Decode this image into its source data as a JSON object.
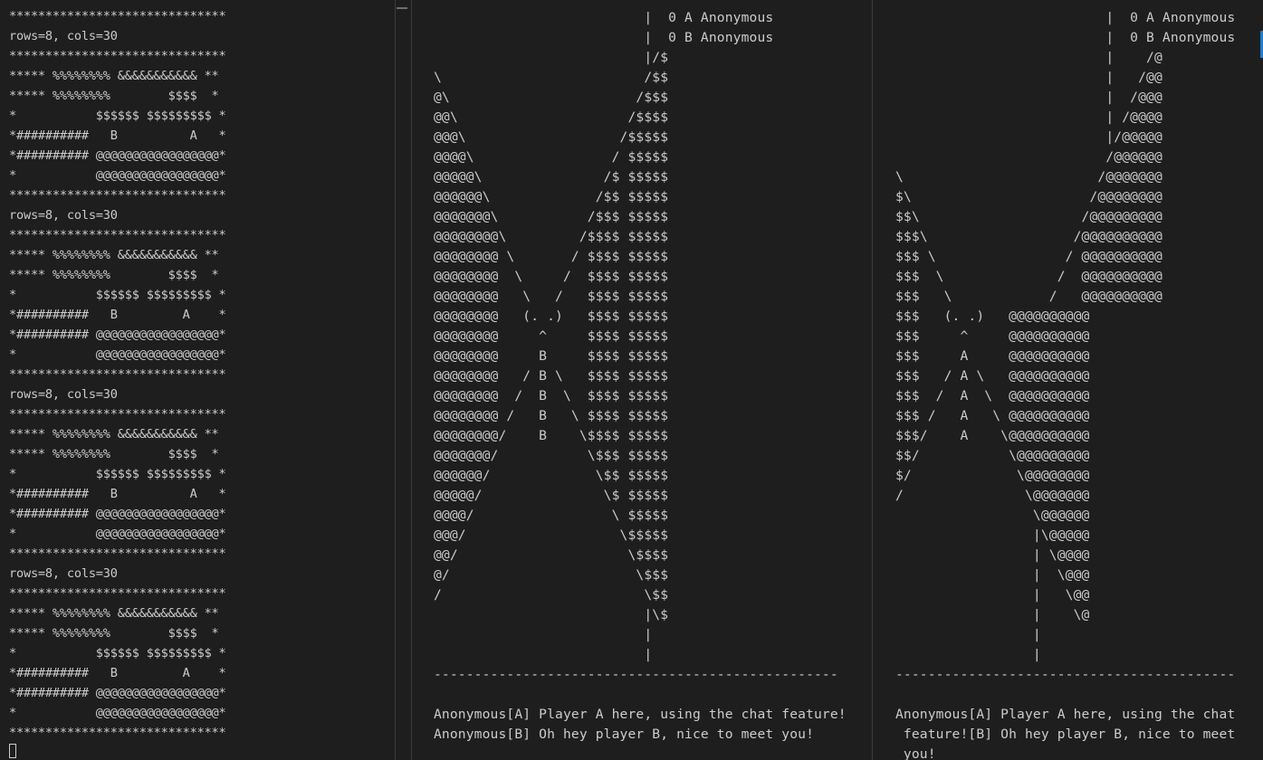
{
  "left_terminal": {
    "lines": [
      "******************************",
      "rows=8, cols=30",
      "******************************",
      "***** %%%%%%%% &&&&&&&&&&& **",
      "***** %%%%%%%%        $$$$  *",
      "*           $$$$$$ $$$$$$$$$ *",
      "*##########   B          A   *",
      "*########## @@@@@@@@@@@@@@@@@*",
      "*           @@@@@@@@@@@@@@@@@*",
      "******************************",
      "rows=8, cols=30",
      "******************************",
      "***** %%%%%%%% &&&&&&&&&&& **",
      "***** %%%%%%%%        $$$$  *",
      "*           $$$$$$ $$$$$$$$$ *",
      "*##########   B         A    *",
      "*########## @@@@@@@@@@@@@@@@@*",
      "*           @@@@@@@@@@@@@@@@@*",
      "******************************",
      "rows=8, cols=30",
      "******************************",
      "***** %%%%%%%% &&&&&&&&&&& **",
      "***** %%%%%%%%        $$$$  *",
      "*           $$$$$$ $$$$$$$$$ *",
      "*##########   B          A   *",
      "*########## @@@@@@@@@@@@@@@@@*",
      "*           @@@@@@@@@@@@@@@@@*",
      "******************************",
      "rows=8, cols=30",
      "******************************",
      "***** %%%%%%%% &&&&&&&&&&& **",
      "***** %%%%%%%%        $$$$  *",
      "*           $$$$$$ $$$$$$$$$ *",
      "*##########   B         A    *",
      "*########## @@@@@@@@@@@@@@@@@*",
      "*           @@@@@@@@@@@@@@@@@*",
      "******************************"
    ]
  },
  "middle_terminal": {
    "lines": [
      "                          |  0 A Anonymous",
      "                          |  0 B Anonymous",
      "                          |/$",
      "\\                         /$$",
      "@\\                       /$$$",
      "@@\\                     /$$$$",
      "@@@\\                   /$$$$$",
      "@@@@\\                 / $$$$$",
      "@@@@@\\               /$ $$$$$",
      "@@@@@@\\             /$$ $$$$$",
      "@@@@@@@\\           /$$$ $$$$$",
      "@@@@@@@@\\         /$$$$ $$$$$",
      "@@@@@@@@ \\       / $$$$ $$$$$",
      "@@@@@@@@  \\     /  $$$$ $$$$$",
      "@@@@@@@@   \\   /   $$$$ $$$$$",
      "@@@@@@@@   (. .)   $$$$ $$$$$",
      "@@@@@@@@     ^     $$$$ $$$$$",
      "@@@@@@@@     B     $$$$ $$$$$",
      "@@@@@@@@   / B \\   $$$$ $$$$$",
      "@@@@@@@@  /  B  \\  $$$$ $$$$$",
      "@@@@@@@@ /   B   \\ $$$$ $$$$$",
      "@@@@@@@@/    B    \\$$$$ $$$$$",
      "@@@@@@@/           \\$$$ $$$$$",
      "@@@@@@/             \\$$ $$$$$",
      "@@@@@/               \\$ $$$$$",
      "@@@@/                 \\ $$$$$",
      "@@@/                   \\$$$$$",
      "@@/                     \\$$$$",
      "@/                       \\$$$",
      "/                         \\$$",
      "                          |\\$",
      "                          |",
      "                          |",
      "--------------------------------------------------",
      "",
      "Anonymous[A] Player A here, using the chat feature!",
      "Anonymous[B] Oh hey player B, nice to meet you!"
    ]
  },
  "right_terminal": {
    "lines": [
      "                          |  0 A Anonymous",
      "                          |  0 B Anonymous",
      "                          |    /@",
      "                          |   /@@",
      "                          |  /@@@",
      "                          | /@@@@",
      "                          |/@@@@@",
      "                          /@@@@@@",
      "\\                        /@@@@@@@",
      "$\\                      /@@@@@@@@",
      "$$\\                    /@@@@@@@@@",
      "$$$\\                  /@@@@@@@@@@",
      "$$$ \\                / @@@@@@@@@@",
      "$$$  \\              /  @@@@@@@@@@",
      "$$$   \\            /   @@@@@@@@@@",
      "$$$   (. .)   @@@@@@@@@@",
      "$$$     ^     @@@@@@@@@@",
      "$$$     A     @@@@@@@@@@",
      "$$$   / A \\   @@@@@@@@@@",
      "$$$  /  A  \\  @@@@@@@@@@",
      "$$$ /   A   \\ @@@@@@@@@@",
      "$$$/    A    \\@@@@@@@@@@",
      "$$/           \\@@@@@@@@@",
      "$/             \\@@@@@@@@",
      "/               \\@@@@@@@",
      "                 \\@@@@@@",
      "                 |\\@@@@@",
      "                 | \\@@@@",
      "                 |  \\@@@",
      "                 |   \\@@",
      "                 |    \\@",
      "                 |",
      "                 |",
      "------------------------------------------",
      "",
      "Anonymous[A] Player A here, using the chat",
      " feature![B] Oh hey player B, nice to meet",
      " you!"
    ]
  }
}
